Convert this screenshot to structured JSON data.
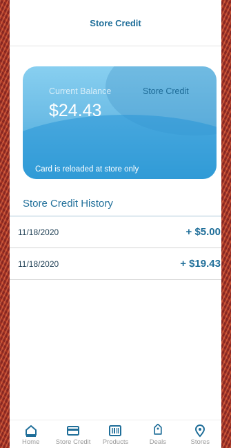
{
  "header": {
    "title": "Store Credit"
  },
  "card": {
    "balance_label": "Current Balance",
    "brand": "Store Credit",
    "amount": "$24.43",
    "note": "Card is reloaded at store only"
  },
  "history": {
    "title": "Store Credit History",
    "rows": [
      {
        "date": "11/18/2020",
        "amount": "+ $5.00"
      },
      {
        "date": "11/18/2020",
        "amount": "+ $19.43"
      }
    ]
  },
  "tabs": [
    {
      "label": "Home",
      "icon": "home-icon"
    },
    {
      "label": "Store Credit",
      "icon": "credit-card-icon"
    },
    {
      "label": "Products",
      "icon": "barcode-icon"
    },
    {
      "label": "Deals",
      "icon": "tag-icon"
    },
    {
      "label": "Stores",
      "icon": "location-pin-icon"
    }
  ],
  "colors": {
    "accent": "#1f6e99",
    "card_light": "#88cff0",
    "card_dark": "#3aa1d6"
  }
}
